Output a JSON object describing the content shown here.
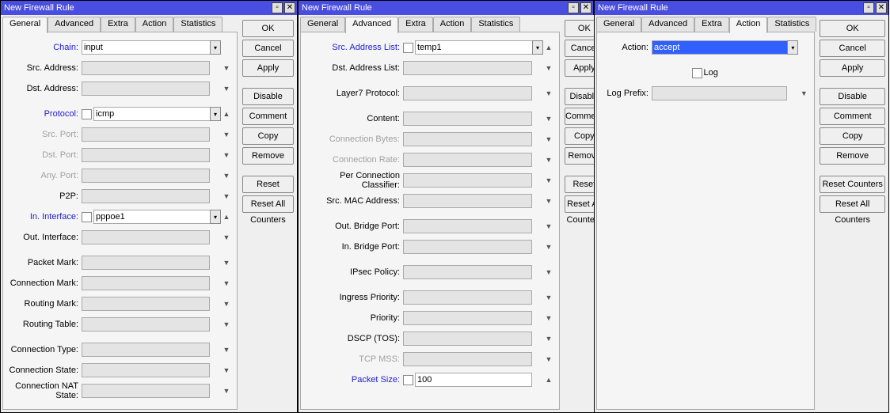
{
  "title": "New Firewall Rule",
  "tabs": {
    "general": "General",
    "advanced": "Advanced",
    "extra": "Extra",
    "action": "Action",
    "statistics": "Statistics"
  },
  "buttons": {
    "ok": "OK",
    "cancel": "Cancel",
    "apply": "Apply",
    "disable": "Disable",
    "comment": "Comment",
    "copy": "Copy",
    "remove": "Remove",
    "reset_counters": "Reset Counters",
    "reset_all": "Reset All Counters"
  },
  "icons": {
    "min": "▫",
    "close": "✕",
    "drop": "▾",
    "up": "▲",
    "down": "▼"
  },
  "general": {
    "labels": {
      "chain": "Chain:",
      "src_addr": "Src. Address:",
      "dst_addr": "Dst. Address:",
      "protocol": "Protocol:",
      "src_port": "Src. Port:",
      "dst_port": "Dst. Port:",
      "any_port": "Any. Port:",
      "p2p": "P2P:",
      "in_if": "In. Interface:",
      "out_if": "Out. Interface:",
      "pkt_mark": "Packet Mark:",
      "conn_mark": "Connection Mark:",
      "rt_mark": "Routing Mark:",
      "rt_table": "Routing Table:",
      "conn_type": "Connection Type:",
      "conn_state": "Connection State:",
      "conn_nat": "Connection NAT State:"
    },
    "values": {
      "chain": "input",
      "protocol": "icmp",
      "in_if": "pppoe1"
    }
  },
  "advanced": {
    "labels": {
      "src_list": "Src. Address List:",
      "dst_list": "Dst. Address List:",
      "l7": "Layer7 Protocol:",
      "content": "Content:",
      "conn_bytes": "Connection Bytes:",
      "conn_rate": "Connection Rate:",
      "pcc": "Per Connection Classifier:",
      "src_mac": "Src. MAC Address:",
      "out_bridge": "Out. Bridge Port:",
      "in_bridge": "In. Bridge Port:",
      "ipsec": "IPsec Policy:",
      "ingress_prio": "Ingress Priority:",
      "priority": "Priority:",
      "dscp": "DSCP (TOS):",
      "tcp_mss": "TCP MSS:",
      "pkt_size": "Packet Size:"
    },
    "values": {
      "src_list": "temp1",
      "pkt_size": "100"
    }
  },
  "action": {
    "labels": {
      "action": "Action:",
      "log": "Log",
      "log_prefix": "Log Prefix:"
    },
    "values": {
      "action": "accept"
    }
  }
}
